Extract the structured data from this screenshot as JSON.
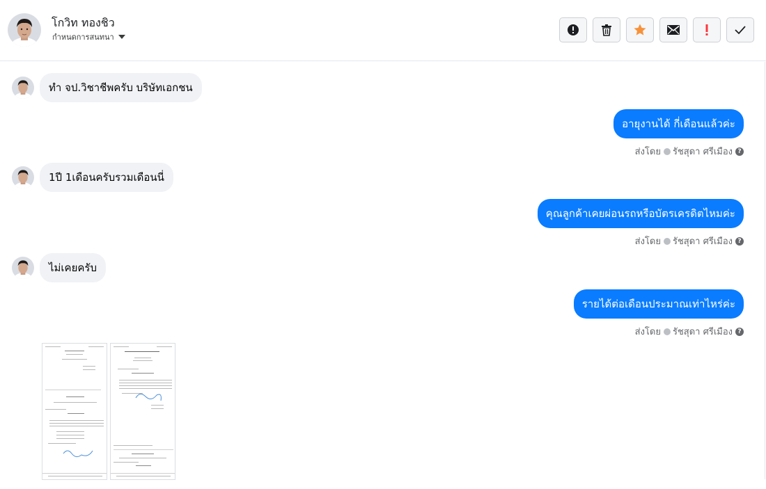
{
  "header": {
    "contact_name": "โกวิท ทองชิว",
    "label_dropdown": "กำหนดการสนทนา",
    "actions": [
      {
        "name": "alert-circle-icon"
      },
      {
        "name": "trash-icon"
      },
      {
        "name": "star-icon",
        "color": "#f7923b"
      },
      {
        "name": "envelope-icon"
      },
      {
        "name": "exclamation-icon",
        "color": "#fa383e"
      },
      {
        "name": "check-icon"
      }
    ]
  },
  "messages": {
    "m1": "ทำ จป.วิชาชีพครับ บริษัทเอกชน",
    "m2": "อายุงานได้ กี่เดือนแล้วค่ะ",
    "m3": "1ปี 1เดือนครับรวมเดือนนี่",
    "m4": "คุณลูกค้าเคยผ่อนรถหรือบัตรเครดิตไหมค่ะ",
    "m5": "ไม่เคยครับ",
    "m6": "รายได้ต่อเดือนประมาณเท่าไหร่ค่ะ"
  },
  "sent_by": {
    "prefix": "ส่งโดย",
    "agent": "รัชสุดา ศรีเมือง",
    "help": "?"
  },
  "colors": {
    "outgoing_bubble": "#0a7cff",
    "incoming_bubble": "#f0f2f5"
  }
}
